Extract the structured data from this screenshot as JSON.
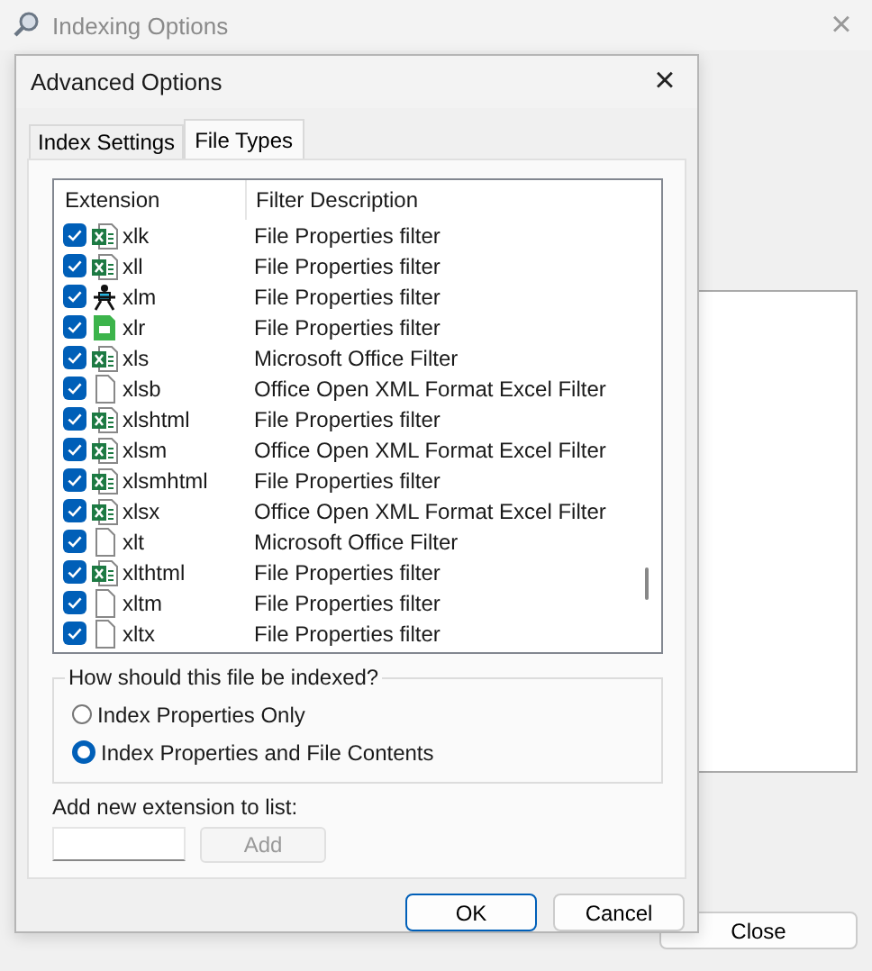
{
  "window": {
    "title": "Indexing Options",
    "close_label": "×",
    "close_button": "Close"
  },
  "dialog": {
    "title": "Advanced Options",
    "close_label": "×",
    "tabs": [
      {
        "label": "Index Settings",
        "selected": false
      },
      {
        "label": "File Types",
        "selected": true
      }
    ],
    "table": {
      "columns": [
        "Extension",
        "Filter Description"
      ],
      "rows": [
        {
          "extension": "xlk",
          "filter": "File Properties filter",
          "checked": true,
          "kind": "excel"
        },
        {
          "extension": "xll",
          "filter": "File Properties filter",
          "checked": true,
          "kind": "excel"
        },
        {
          "extension": "xlm",
          "filter": "File Properties filter",
          "checked": true,
          "kind": "setup"
        },
        {
          "extension": "xlr",
          "filter": "File Properties filter",
          "checked": true,
          "kind": "green"
        },
        {
          "extension": "xls",
          "filter": "Microsoft Office Filter",
          "checked": true,
          "kind": "excel"
        },
        {
          "extension": "xlsb",
          "filter": "Office Open XML Format Excel Filter",
          "checked": true,
          "kind": "blank"
        },
        {
          "extension": "xlshtml",
          "filter": "File Properties filter",
          "checked": true,
          "kind": "excel"
        },
        {
          "extension": "xlsm",
          "filter": "Office Open XML Format Excel Filter",
          "checked": true,
          "kind": "excel"
        },
        {
          "extension": "xlsmhtml",
          "filter": "File Properties filter",
          "checked": true,
          "kind": "excel"
        },
        {
          "extension": "xlsx",
          "filter": "Office Open XML Format Excel Filter",
          "checked": true,
          "kind": "excel"
        },
        {
          "extension": "xlt",
          "filter": "Microsoft Office Filter",
          "checked": true,
          "kind": "blank"
        },
        {
          "extension": "xlthtml",
          "filter": "File Properties filter",
          "checked": true,
          "kind": "excel"
        },
        {
          "extension": "xltm",
          "filter": "File Properties filter",
          "checked": true,
          "kind": "blank"
        },
        {
          "extension": "xltx",
          "filter": "File Properties filter",
          "checked": true,
          "kind": "blank"
        }
      ]
    },
    "group": {
      "title": "How should this file be indexed?",
      "options": [
        {
          "label": "Index Properties Only",
          "selected": false
        },
        {
          "label": "Index Properties and File Contents",
          "selected": true
        }
      ]
    },
    "add_label": "Add new extension to list:",
    "add_button": "Add",
    "add_disabled": true,
    "buttons": [
      "OK",
      "Cancel"
    ]
  }
}
